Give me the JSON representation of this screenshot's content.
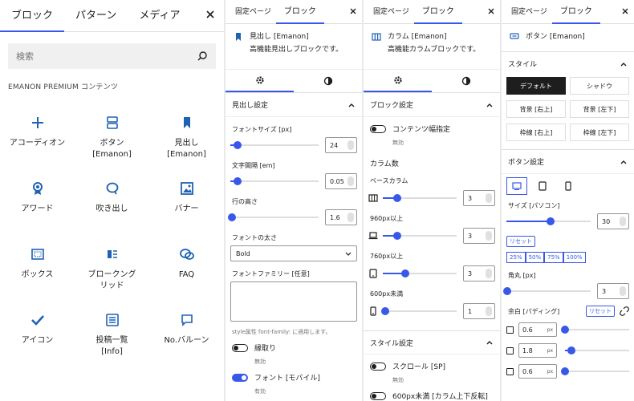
{
  "inserter": {
    "tabs": [
      "ブロック",
      "パターン",
      "メディア"
    ],
    "search_placeholder": "検索",
    "category": "EMANON PREMIUM コンテンツ",
    "blocks": [
      {
        "label": "アコーディオン",
        "icon": "plus-icon"
      },
      {
        "label": "ボタン\n[Emanon]",
        "icon": "button-icon"
      },
      {
        "label": "見出し\n[Emanon]",
        "icon": "bookmark-icon"
      },
      {
        "label": "アワード",
        "icon": "award-icon"
      },
      {
        "label": "吹き出し",
        "icon": "speech-bubble-icon"
      },
      {
        "label": "バナー",
        "icon": "image-icon"
      },
      {
        "label": "ボックス",
        "icon": "box-icon"
      },
      {
        "label": "ブロークング\nリッド",
        "icon": "broken-grid-icon"
      },
      {
        "label": "FAQ",
        "icon": "faq-icon"
      },
      {
        "label": "アイコン",
        "icon": "check-icon"
      },
      {
        "label": "投稿一覧\n[Info]",
        "icon": "post-list-icon"
      },
      {
        "label": "No.バルーン",
        "icon": "comment-icon"
      }
    ]
  },
  "heading_panel": {
    "tabs": [
      "固定ページ",
      "ブロック"
    ],
    "block_name": "見出し [Emanon]",
    "block_desc": "高機能見出しブロックです。",
    "section": "見出し設定",
    "font_size_label": "フォントサイズ [px]",
    "font_size": "24",
    "font_size_pct": 0.08,
    "letter_spacing_label": "文字間隔 [em]",
    "letter_spacing": "0.05",
    "letter_spacing_pct": 0.08,
    "line_height_label": "行の高さ",
    "line_height": "1.6",
    "line_height_pct": 0.02,
    "font_weight_label": "フォントの太さ",
    "font_weight": "Bold",
    "font_family_label": "フォントファミリー [任意]",
    "font_family_note": "style属性 font-family: に適用します。",
    "toggle1_label": "縁取り",
    "toggle1_state": "無効",
    "toggle2_label": "フォント [モバイル]",
    "toggle2_state": "有効"
  },
  "column_panel": {
    "tabs": [
      "固定ページ",
      "ブロック"
    ],
    "block_name": "カラム [Emanon]",
    "block_desc": "高機能カラムブロックです。",
    "section": "ブロック設定",
    "toggle_label": "コンテンツ幅指定",
    "toggle_state": "無効",
    "columns_label": "カラム数",
    "base_label": "ベースカラム",
    "rows": [
      {
        "label": "",
        "value": "3",
        "pct": 0.2,
        "icon": "desktop-icon"
      },
      {
        "label": "960px以上",
        "value": "3",
        "pct": 0.2,
        "icon": "laptop-icon"
      },
      {
        "label": "760px以上",
        "value": "3",
        "pct": 0.3,
        "icon": "tablet-icon"
      },
      {
        "label": "600px未満",
        "value": "1",
        "pct": 0.03,
        "icon": "mobile-icon"
      }
    ],
    "section2": "スタイル設定",
    "scroll_label": "スクロール [SP]",
    "scroll_state": "無効",
    "reverse_label": "600px未満 [カラム上下反転]"
  },
  "button_panel": {
    "tabs": [
      "固定ページ",
      "ブロック"
    ],
    "block_name": "ボタン [Emanon]",
    "style_section": "スタイル",
    "styles": [
      "デフォルト",
      "シャドウ",
      "背景 [右上]",
      "背景 [左下]",
      "枠線 [右上]",
      "枠線 [左下]"
    ],
    "settings_section": "ボタン設定",
    "size_label": "サイズ [パソコン]",
    "size_value": "30",
    "size_pct": 0.52,
    "reset": "リセット",
    "percents": [
      "25%",
      "50%",
      "75%",
      "100%"
    ],
    "radius_label": "角丸 [px]",
    "radius_value": "3",
    "radius_pct": 0.01,
    "padding_label": "余白 [パディング]",
    "padding_rows": [
      {
        "value": "0.6",
        "unit": "px",
        "pct": 0.0
      },
      {
        "value": "1.8",
        "unit": "px",
        "pct": 0.1
      },
      {
        "value": "0.6",
        "unit": "px",
        "pct": 0.0
      }
    ]
  },
  "colors": {
    "accent": "#3858e9",
    "icon": "#1e62b3",
    "text": "#1e1e1e"
  }
}
